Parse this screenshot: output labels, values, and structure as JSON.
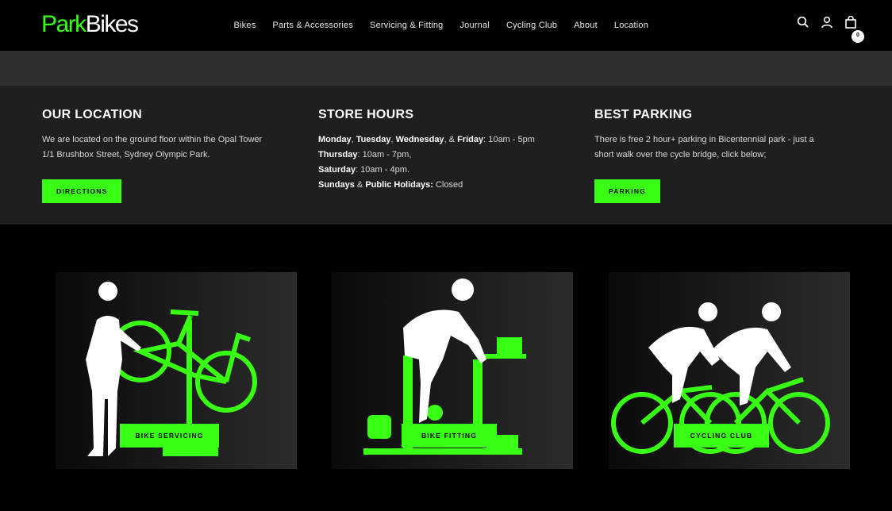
{
  "header": {
    "logo_left": "Park",
    "logo_right": "Bikes",
    "nav": [
      "Bikes",
      "Parts & Accessories",
      "Servicing & Fitting",
      "Journal",
      "Cycling Club",
      "About",
      "Location"
    ],
    "cart_count": "0"
  },
  "location": {
    "title": "OUR LOCATION",
    "line1": "We are located on the ground floor within the Opal Tower",
    "line2": "1/1 Brushbox Street, Sydney Olympic Park.",
    "button": "DIRECTIONS"
  },
  "hours": {
    "title": "STORE HOURS",
    "r1_days_a": "Monday",
    "r1_sep1": ", ",
    "r1_days_b": "Tuesday",
    "r1_sep2": ", ",
    "r1_days_c": "Wednesday",
    "r1_sep3": ", & ",
    "r1_days_d": "Friday",
    "r1_time": ": 10am - 5pm",
    "r2_day": "Thursday",
    "r2_time": ": 10am - 7pm,",
    "r3_day": "Saturday",
    "r3_time": ": 10am - 4pm.",
    "r4_day_a": "Sundays",
    "r4_sep": " & ",
    "r4_day_b": "Public Holidays:",
    "r4_time": " Closed"
  },
  "parking": {
    "title": "BEST PARKING",
    "line1": "There is free 2 hour+ parking in Bicentennial park - just a",
    "line2": "short walk over the cycle bridge, click below;",
    "button": "PARKING"
  },
  "cards": [
    {
      "label": "BIKE SERVICING"
    },
    {
      "label": "BIKE FITTING"
    },
    {
      "label": "CYCLING CLUB"
    }
  ],
  "colors": {
    "accent": "#39ff14",
    "background": "#000000",
    "panel": "#1f1f1f"
  }
}
